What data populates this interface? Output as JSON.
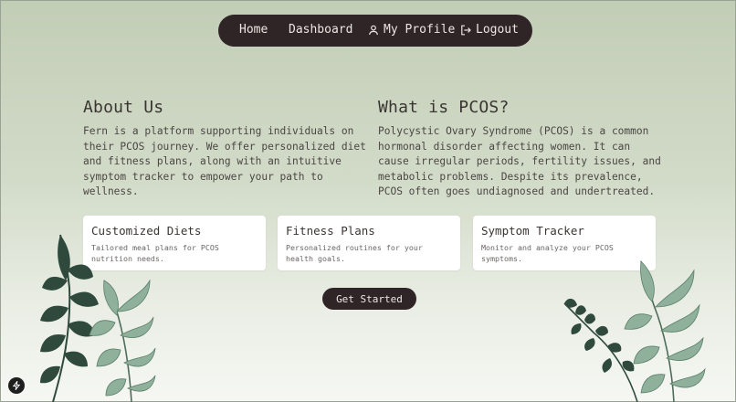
{
  "nav": {
    "home": "Home",
    "dashboard": "Dashboard",
    "profile": "My Profile",
    "logout": "Logout",
    "profile_icon": "user-icon",
    "logout_icon": "logout-icon"
  },
  "about": {
    "title": "About Us",
    "body": "Fern is a platform supporting individuals on their PCOS journey. We offer personalized diet and fitness plans, along with an intuitive symptom tracker to empower your path to wellness."
  },
  "pcos": {
    "title": "What is PCOS?",
    "body": "Polycystic Ovary Syndrome (PCOS) is a common hormonal disorder affecting women. It can cause irregular periods, fertility issues, and metabolic problems. Despite its prevalence, PCOS often goes undiagnosed and undertreated."
  },
  "cards": [
    {
      "title": "Customized Diets",
      "desc": "Tailored meal plans for PCOS nutrition needs."
    },
    {
      "title": "Fitness Plans",
      "desc": "Personalized routines for your health goals."
    },
    {
      "title": "Symptom Tracker",
      "desc": "Monitor and analyze your PCOS symptoms."
    }
  ],
  "cta": "Get Started",
  "colors": {
    "nav_bg": "#2f2526",
    "bg_top": "#c2cdb6",
    "bg_bottom": "#f6f7f3",
    "leaf_dark": "#2f4a3d",
    "leaf_light": "#8fb09a"
  },
  "icons": [
    "user-icon",
    "logout-icon",
    "bolt-icon",
    "fern-leaves"
  ]
}
